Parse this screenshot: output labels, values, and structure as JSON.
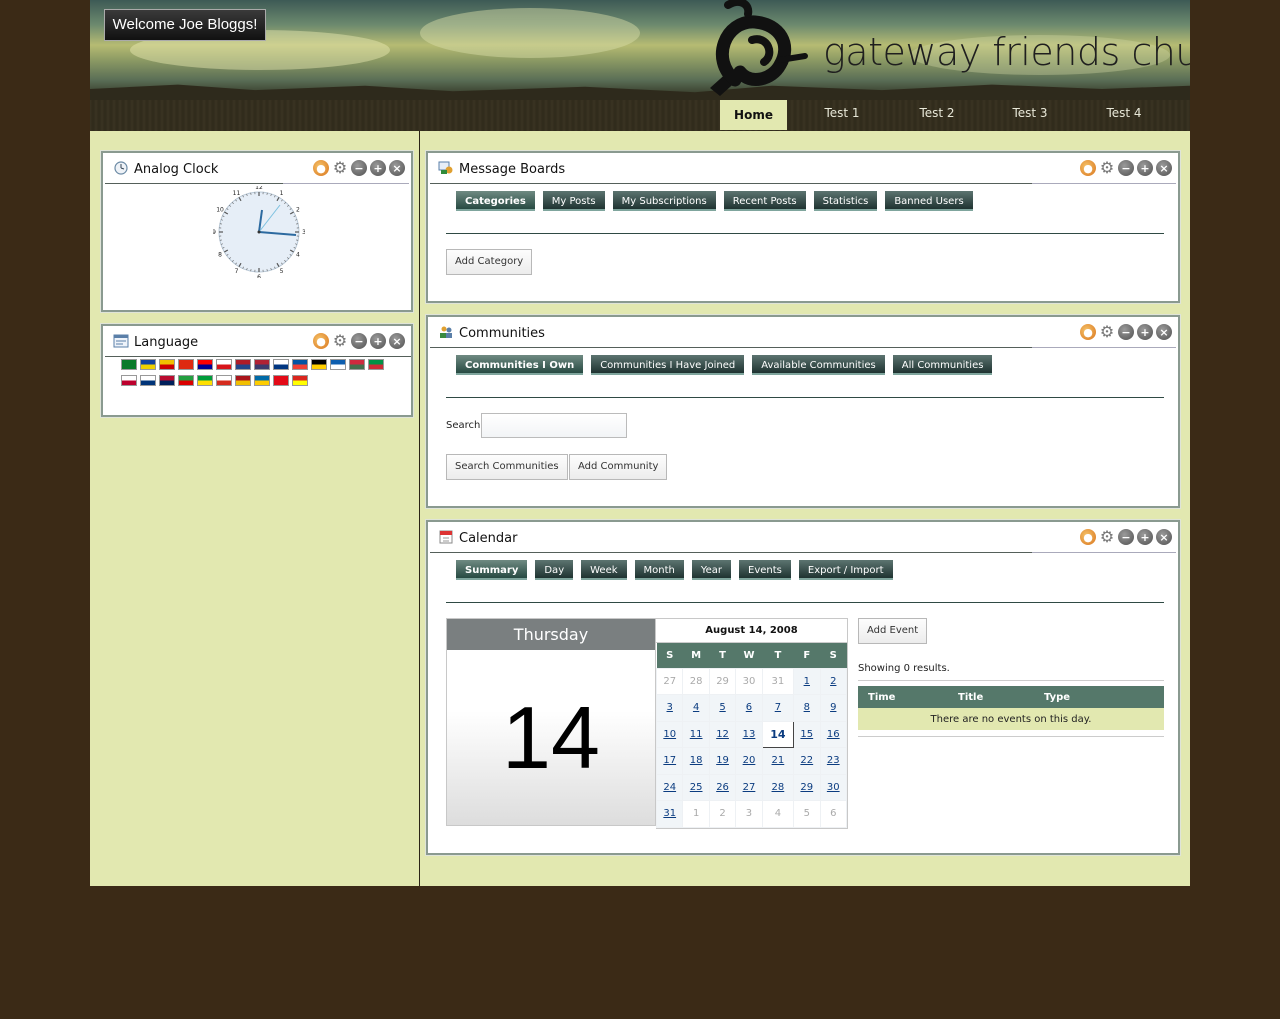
{
  "header": {
    "welcome": "Welcome Joe Bloggs!",
    "site_name": "gateway friends church"
  },
  "nav": {
    "items": [
      "Home",
      "Test 1",
      "Test 2",
      "Test 3",
      "Test 4"
    ],
    "active": "Home"
  },
  "portlets": {
    "clock": {
      "title": "Analog Clock",
      "time": "2:11"
    },
    "language": {
      "title": "Language",
      "flags_row1": [
        "ar_SA",
        "ca_AD",
        "ca_ES",
        "zh_CN",
        "zh_TW",
        "cs_CZ",
        "nl_NL",
        "en_US",
        "fi_FI",
        "fr_FR",
        "de_DE",
        "el_GR",
        "hu_HU",
        "it_IT"
      ],
      "flags_row2": [
        "ja_JP",
        "ko_KR",
        "nb_NO",
        "fa_IR",
        "pt_BR",
        "ru_RU",
        "es_ES",
        "sv_SE",
        "tr_TR",
        "vi_VN"
      ]
    },
    "message_boards": {
      "title": "Message Boards",
      "tabs": [
        "Categories",
        "My Posts",
        "My Subscriptions",
        "Recent Posts",
        "Statistics",
        "Banned Users"
      ],
      "active_tab": "Categories",
      "add_category": "Add Category"
    },
    "communities": {
      "title": "Communities",
      "tabs": [
        "Communities I Own",
        "Communities I Have Joined",
        "Available Communities",
        "All Communities"
      ],
      "active_tab": "Communities I Own",
      "search_label": "Search",
      "search_value": "",
      "search_button": "Search Communities",
      "add_button": "Add Community"
    },
    "calendar": {
      "title": "Calendar",
      "tabs": [
        "Summary",
        "Day",
        "Week",
        "Month",
        "Year",
        "Events",
        "Export / Import"
      ],
      "active_tab": "Summary",
      "day_name": "Thursday",
      "day_number": "14",
      "month_title": "August 14, 2008",
      "weekday_headers": [
        "S",
        "M",
        "T",
        "W",
        "T",
        "F",
        "S"
      ],
      "weeks": [
        [
          "27",
          "28",
          "29",
          "30",
          "31",
          "1",
          "2"
        ],
        [
          "3",
          "4",
          "5",
          "6",
          "7",
          "8",
          "9"
        ],
        [
          "10",
          "11",
          "12",
          "13",
          "14",
          "15",
          "16"
        ],
        [
          "17",
          "18",
          "19",
          "20",
          "21",
          "22",
          "23"
        ],
        [
          "24",
          "25",
          "26",
          "27",
          "28",
          "29",
          "30"
        ],
        [
          "31",
          "1",
          "2",
          "3",
          "4",
          "5",
          "6"
        ]
      ],
      "add_event": "Add Event",
      "results_text": "Showing 0 results.",
      "columns": [
        "Time",
        "Title",
        "Type"
      ],
      "empty_text": "There are no events on this day."
    }
  },
  "colors": {
    "page_bg": "#3b2a16",
    "content_bg": "#e2e8b0",
    "tab_bg": "#1f3331",
    "table_header": "#55786a"
  }
}
